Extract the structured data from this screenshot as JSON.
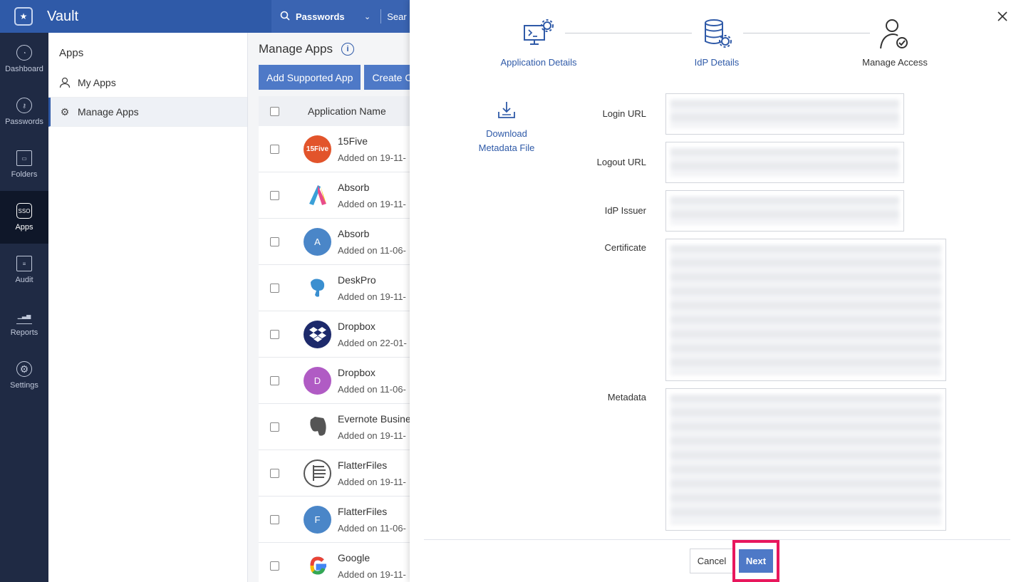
{
  "topbar": {
    "app_title": "Vault",
    "search_type": "Passwords",
    "search_placeholder": "Sear"
  },
  "leftnav": [
    {
      "label": "Dashboard",
      "icon": "dashboard-icon"
    },
    {
      "label": "Passwords",
      "icon": "key-icon"
    },
    {
      "label": "Folders",
      "icon": "folder-icon"
    },
    {
      "label": "Apps",
      "icon": "sso-icon",
      "active": true
    },
    {
      "label": "Audit",
      "icon": "audit-icon"
    },
    {
      "label": "Reports",
      "icon": "reports-icon"
    },
    {
      "label": "Settings",
      "icon": "gear-icon"
    }
  ],
  "subnav": {
    "title": "Apps",
    "items": [
      {
        "label": "My Apps",
        "icon": "user-icon"
      },
      {
        "label": "Manage Apps",
        "icon": "gear-icon",
        "active": true
      }
    ]
  },
  "main": {
    "title": "Manage Apps",
    "buttons": [
      "Add Supported App",
      "Create Cu"
    ],
    "column_header": "Application Name",
    "rows": [
      {
        "name": "15Five",
        "added": "Added on 19-11-",
        "avatar_text": "15Five",
        "color": "#e2542b"
      },
      {
        "name": "Absorb",
        "added": "Added on 19-11-",
        "avatar_text": "",
        "color": "#ffffff"
      },
      {
        "name": "Absorb",
        "added": "Added on 11-06-",
        "avatar_text": "A",
        "color": "#4a86c8"
      },
      {
        "name": "DeskPro",
        "added": "Added on 19-11-",
        "avatar_text": "",
        "color": "#ffffff"
      },
      {
        "name": "Dropbox",
        "added": "Added on 22-01-",
        "avatar_text": "",
        "color": "#1d2a6b"
      },
      {
        "name": "Dropbox",
        "added": "Added on 11-06-",
        "avatar_text": "D",
        "color": "#b05bc4"
      },
      {
        "name": "Evernote Busine",
        "added": "Added on 19-11-",
        "avatar_text": "",
        "color": "#ffffff"
      },
      {
        "name": "FlatterFiles",
        "added": "Added on 19-11-",
        "avatar_text": "",
        "color": "#ffffff"
      },
      {
        "name": "FlatterFiles",
        "added": "Added on 11-06-",
        "avatar_text": "F",
        "color": "#4a86c8"
      },
      {
        "name": "Google",
        "added": "Added on 19-11-",
        "avatar_text": "",
        "color": "#ffffff"
      }
    ]
  },
  "modal": {
    "steps": [
      {
        "label": "Application Details",
        "color": "#2f5aa8"
      },
      {
        "label": "IdP Details",
        "color": "#2f5aa8"
      },
      {
        "label": "Manage Access",
        "color": "#333333"
      }
    ],
    "download_label_line1": "Download",
    "download_label_line2": "Metadata File",
    "fields": {
      "login_url": "Login URL",
      "logout_url": "Logout URL",
      "idp_issuer": "IdP Issuer",
      "certificate": "Certificate",
      "metadata": "Metadata"
    },
    "cancel_label": "Cancel",
    "next_label": "Next"
  },
  "colors": {
    "accent": "#2f5aa8",
    "nav_bg": "#1f2a44",
    "highlight": "#e8175d"
  }
}
